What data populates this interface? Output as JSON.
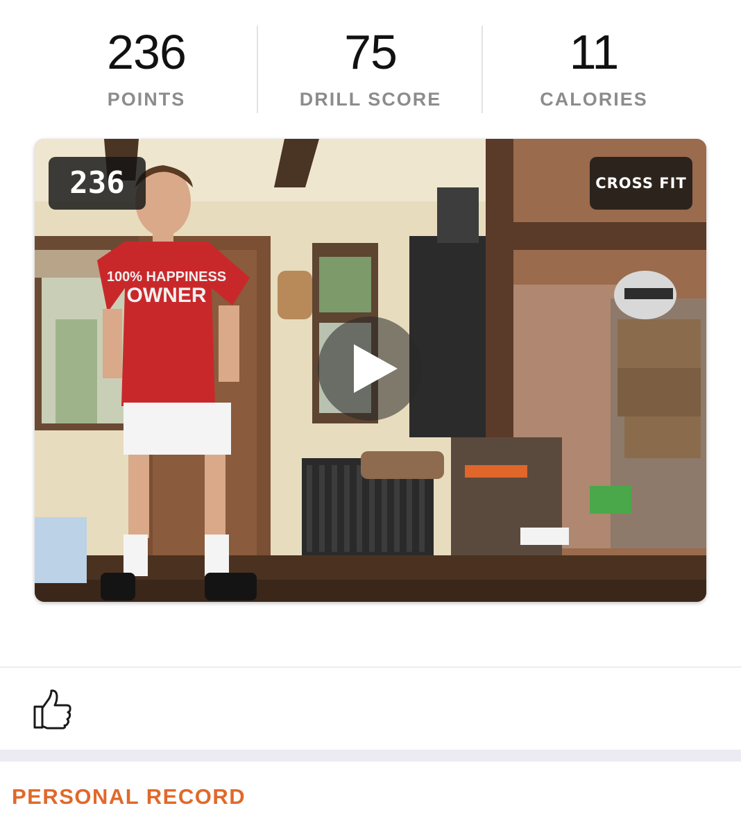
{
  "stats": [
    {
      "value": "236",
      "label": "POINTS"
    },
    {
      "value": "75",
      "label": "DRILL SCORE"
    },
    {
      "value": "11",
      "label": "CALORIES"
    }
  ],
  "video": {
    "score_badge": "236",
    "type_badge": "CROSS FIT",
    "play_icon": "play-icon",
    "shirt_text": [
      "100% HAPPINESS",
      "OWNER"
    ]
  },
  "actions": {
    "like_icon": "thumbs-up-icon"
  },
  "section": {
    "title": "PERSONAL RECORD"
  },
  "colors": {
    "accent": "#e0692a",
    "label_gray": "#8c8c8c",
    "band": "#ecebf3"
  }
}
